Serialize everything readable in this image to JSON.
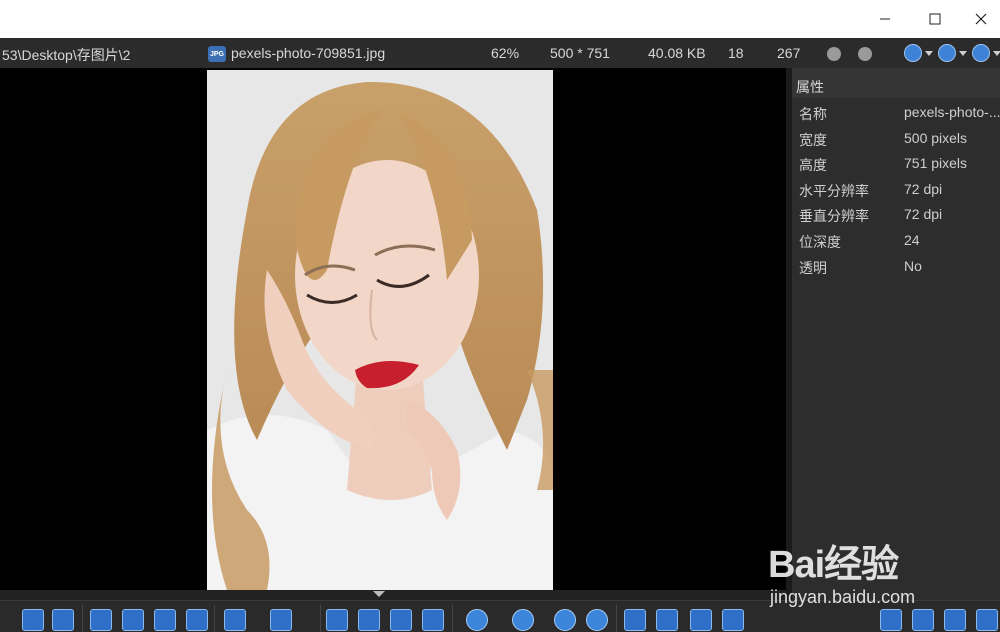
{
  "window": {
    "minimize_glyph": "—",
    "maximize_glyph": "☐",
    "close_glyph": "✕"
  },
  "infobar": {
    "path": "53\\Desktop\\存图片\\2",
    "file_badge": "JPG",
    "filename": "pexels-photo-709851.jpg",
    "zoom": "62%",
    "dimensions": "500 * 751",
    "filesize": "40.08 KB",
    "index": "18",
    "total": "267"
  },
  "panel": {
    "title": "属性",
    "properties": [
      {
        "key": "名称",
        "value": "pexels-photo-..."
      },
      {
        "key": "宽度",
        "value": "500 pixels"
      },
      {
        "key": "高度",
        "value": "751 pixels"
      },
      {
        "key": "水平分辨率",
        "value": "72 dpi"
      },
      {
        "key": "垂直分辨率",
        "value": "72 dpi"
      },
      {
        "key": "位深度",
        "value": "24"
      },
      {
        "key": "透明",
        "value": "No"
      }
    ]
  },
  "watermark": {
    "brand": "Bai经验",
    "url": "jingyan.baidu.com"
  },
  "colors": {
    "accent": "#3e82d6",
    "background": "#000000",
    "panel": "#2d2d2d"
  }
}
